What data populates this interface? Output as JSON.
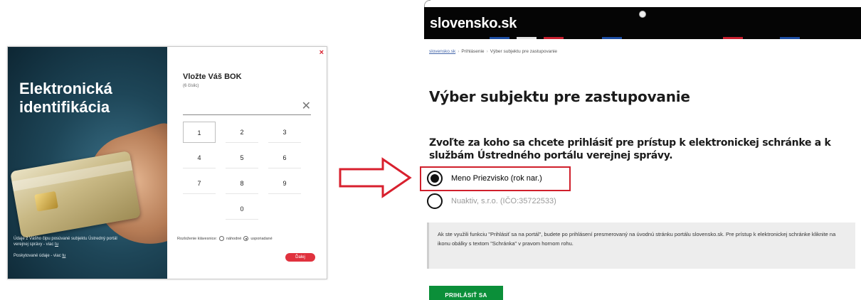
{
  "eid_dialog": {
    "heading_line1": "Elektronická",
    "heading_line2": "identifikácia",
    "footnote1": "Údaje z Vášho čipu posúvané subjektu Ústredný portál verejnej správy - viac",
    "footnote1_link": "tu",
    "footnote2": "Poskytované údaje - viac",
    "footnote2_link": "tu",
    "close_label": "×",
    "bok_title": "Vložte Váš BOK",
    "bok_subtitle": "(6 číslic)",
    "clear_label": "✕",
    "keys": [
      "1",
      "2",
      "3",
      "4",
      "5",
      "6",
      "7",
      "8",
      "9",
      "0"
    ],
    "layout_label": "Rozloženie klávesnice:",
    "layout_options": [
      "náhodné",
      "usporiadané"
    ],
    "layout_selected": "usporiadané",
    "next_label": "Ďalej"
  },
  "portal": {
    "logo": "slovensko.sk",
    "breadcrumb": [
      "slovensko.sk",
      "Prihlásenie",
      "Výber subjektu pre zastupovanie"
    ],
    "title": "Výber subjektu pre zastupovanie",
    "question": "Zvoľte za koho sa chcete prihlásiť pre prístup k elektronickej schránke a k službám Ústredného portálu verejnej správy.",
    "options": [
      {
        "label": "Meno Priezvisko (rok nar.)",
        "selected": true
      },
      {
        "label": "Nuaktiv, s.r.o. (IČO:35722533)",
        "selected": false
      }
    ],
    "info_text": "Ak ste využili funkciu \"Prihlásiť sa na portál\", budete po prihlásení presmerovaný na úvodnú stránku portálu slovensko.sk. Pre prístup k elektronickej schránke kliknite na ikonu obálky s textom \"Schránka\" v pravom hornom rohu.",
    "login_label": "PRIHLÁSIŤ SA"
  },
  "colors": {
    "portal_header": "#050505",
    "login_button": "#0b8f39",
    "highlight": "#d01f2b",
    "dialog_accent": "#e0323e"
  }
}
